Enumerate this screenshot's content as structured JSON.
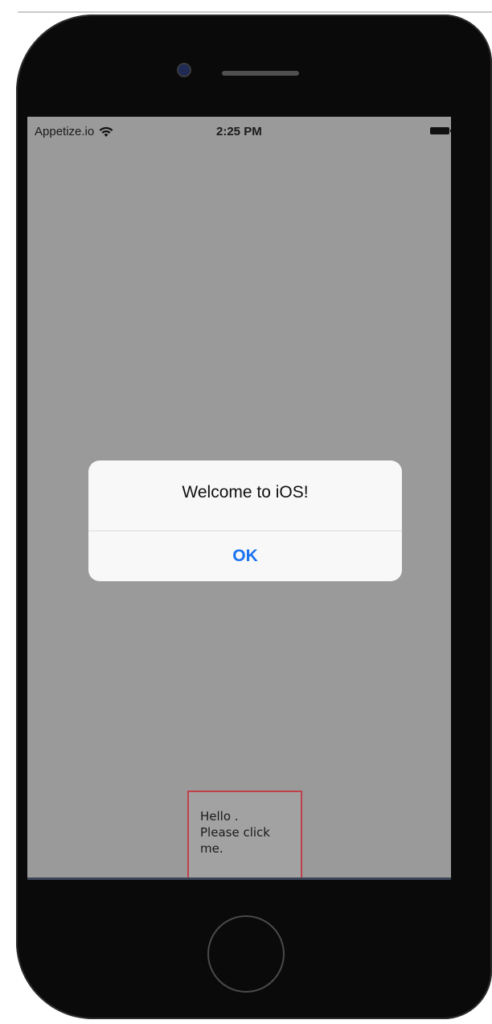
{
  "status_bar": {
    "carrier": "Appetize.io",
    "time": "2:25 PM",
    "wifi_icon": "wifi-icon",
    "battery_icon": "battery-icon"
  },
  "alert": {
    "title": "Welcome to iOS!",
    "ok_label": "OK",
    "ok_color": "#1a73f0"
  },
  "content": {
    "hello_text": "Hello .\nPlease click\nme."
  },
  "colors": {
    "screen_background": "#9a9a9a",
    "phone_body": "#0a0a0a",
    "highlight_border": "#c0404a"
  },
  "hardware": {
    "camera_icon": "camera-icon",
    "speaker_icon": "speaker-grille-icon",
    "home_button_icon": "home-button-icon"
  }
}
